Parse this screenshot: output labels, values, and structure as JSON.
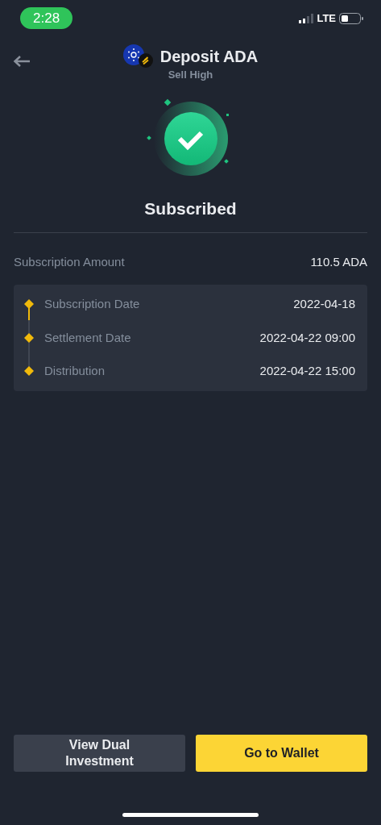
{
  "status_bar": {
    "time": "2:28",
    "network": "LTE"
  },
  "header": {
    "title": "Deposit ADA",
    "subtitle": "Sell High"
  },
  "status": {
    "title": "Subscribed"
  },
  "amount": {
    "label": "Subscription Amount",
    "value": "110.5 ADA"
  },
  "timeline": [
    {
      "label": "Subscription Date",
      "value": "2022-04-18"
    },
    {
      "label": "Settlement Date",
      "value": "2022-04-22 09:00"
    },
    {
      "label": "Distribution",
      "value": "2022-04-22 15:00"
    }
  ],
  "buttons": [
    {
      "label": "View Dual Investment",
      "kind": "secondary"
    },
    {
      "label": "Go to Wallet",
      "kind": "primary"
    }
  ]
}
